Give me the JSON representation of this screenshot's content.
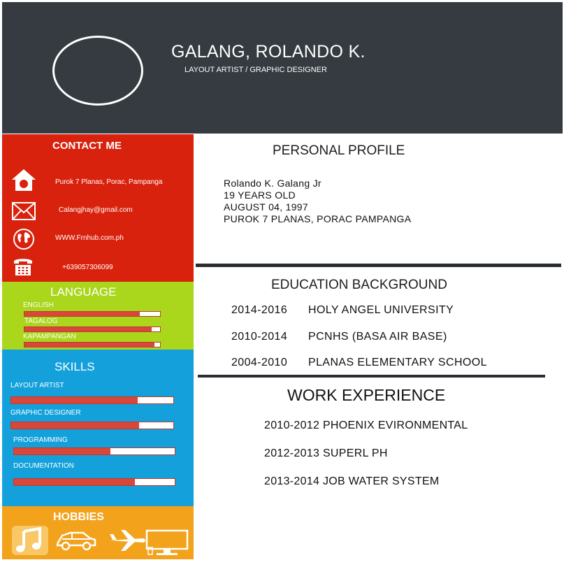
{
  "header": {
    "name": "GALANG, ROLANDO K.",
    "job_title": "LAYOUT ARTIST / GRAPHIC DESIGNER"
  },
  "contact": {
    "title": "CONTACT ME",
    "address": "Purok 7 Planas, Porac, Pampanga",
    "email": "Calangjhay@gmail.com",
    "website": "WWW.Frnhub.com.ph",
    "phone": "+639057306099"
  },
  "language": {
    "title": "LANGUAGE",
    "items": [
      {
        "label": "ENGLISH",
        "level": 0.85
      },
      {
        "label": "TAGALOG",
        "level": 0.94
      },
      {
        "label": "KAPAMPANGAN",
        "level": 0.96
      }
    ]
  },
  "skills": {
    "title": "SKILLS",
    "items": [
      {
        "label": "LAYOUT ARTIST",
        "level": 0.78
      },
      {
        "label": "GRAPHIC DESIGNER",
        "level": 0.79
      },
      {
        "label": "PROGRAMMING",
        "level": 0.6
      },
      {
        "label": "DOCUMENTATION",
        "level": 0.75
      }
    ]
  },
  "hobbies": {
    "title": "HOBBIES",
    "icons": [
      "music-icon",
      "car-icon",
      "airplane-icon",
      "computer-icon"
    ]
  },
  "profile": {
    "title": "PERSONAL PROFILE",
    "lines": [
      "Rolando K. Galang Jr",
      "19 YEARS OLD",
      "AUGUST 04, 1997",
      "PUROK 7 PLANAS, PORAC PAMPANGA"
    ]
  },
  "education": {
    "title": "EDUCATION BACKGROUND",
    "items": [
      {
        "years": "2014-2016",
        "school": "HOLY ANGEL UNIVERSITY"
      },
      {
        "years": "2010-2014",
        "school": "PCNHS (BASA AIR BASE)"
      },
      {
        "years": "2004-2010",
        "school": "PLANAS ELEMENTARY SCHOOL"
      }
    ]
  },
  "work": {
    "title": "WORK EXPERIENCE",
    "items": [
      "2010-2012 PHOENIX EVIRONMENTAL",
      "2012-2013 SUPERL PH",
      "2013-2014  JOB WATER SYSTEM"
    ]
  },
  "colors": {
    "header": "#353b40",
    "contact": "#d9220d",
    "language": "#aad61c",
    "skills": "#14a1db",
    "hobbies": "#f2a21b",
    "bar": "#d9463a"
  }
}
